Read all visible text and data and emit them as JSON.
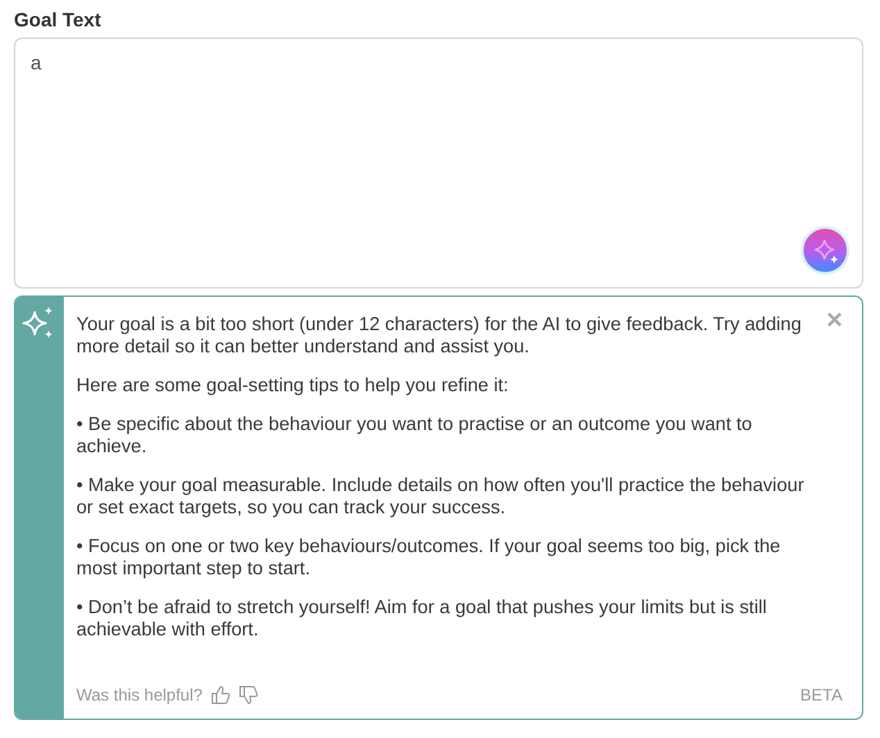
{
  "label": "Goal Text",
  "goal_field": {
    "value": "a"
  },
  "feedback": {
    "paragraphs": [
      "Your goal is a bit too short (under 12 characters) for the AI to give feedback. Try adding more detail so it can better understand and assist you.",
      "Here are some goal-setting tips to help you refine it:",
      "• Be specific about the behaviour you want to practise or an outcome you want to achieve.",
      "• Make your goal measurable. Include details on how often you'll practice the behaviour or set exact targets, so you can track your success.",
      "• Focus on one or two key behaviours/outcomes. If your goal seems too big, pick the most important step to start.",
      "• Don’t be afraid to stretch yourself! Aim for a goal that pushes your limits but is still achievable with effort."
    ],
    "close": "×",
    "helpful_prompt": "Was this helpful?",
    "badge": "BETA"
  }
}
